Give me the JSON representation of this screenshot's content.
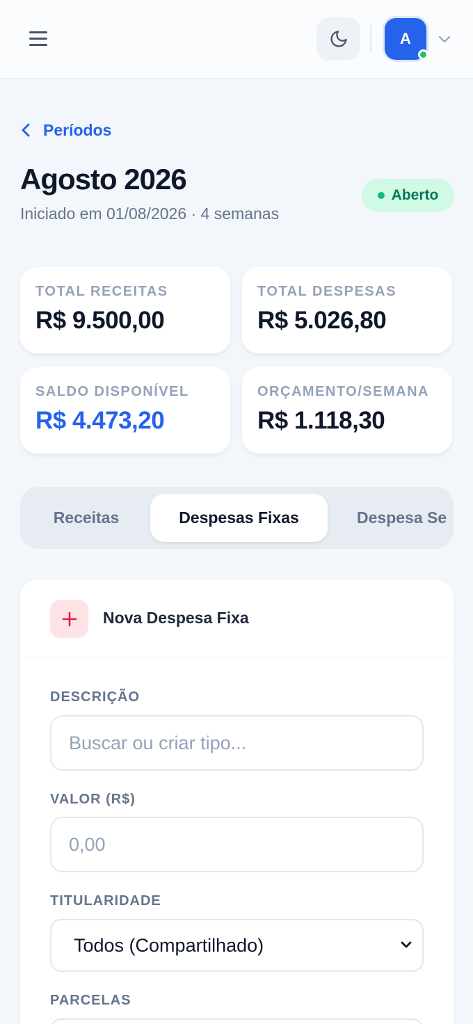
{
  "header": {
    "menu_icon": "hamburger-menu-icon",
    "theme_icon": "moon-icon",
    "avatar_initial": "A",
    "avatar_status": "online",
    "chevron_icon": "chevron-down-icon"
  },
  "nav": {
    "back_label": "Períodos"
  },
  "period": {
    "title": "Agosto 2026",
    "subtitle": "Iniciado em 01/08/2026 · 4 semanas",
    "status": "Aberto"
  },
  "stats": [
    {
      "label": "TOTAL RECEITAS",
      "value": "R$ 9.500,00"
    },
    {
      "label": "TOTAL DESPESAS",
      "value": "R$ 5.026,80"
    },
    {
      "label": "SALDO DISPONÍVEL",
      "value": "R$ 4.473,20"
    },
    {
      "label": "ORÇAMENTO/SEMANA",
      "value": "R$ 1.118,30"
    }
  ],
  "tabs": [
    {
      "label": "Receitas",
      "active": false
    },
    {
      "label": "Despesas Fixas",
      "active": true
    },
    {
      "label": "Despesa Se",
      "active": false
    }
  ],
  "form": {
    "title": "Nova Despesa Fixa",
    "description": {
      "label": "DESCRIÇÃO",
      "value": "",
      "placeholder": "Buscar ou criar tipo..."
    },
    "amount": {
      "label": "VALOR (R$)",
      "value": "",
      "placeholder": "0,00"
    },
    "ownership": {
      "label": "TITULARIDADE",
      "selected": "Todos (Compartilhado)"
    },
    "installments": {
      "label": "PARCELAS"
    }
  },
  "colors": {
    "accent": "#2563eb",
    "status_green": "#047857",
    "add_icon": "#e11d48",
    "background": "#f3f6fa"
  }
}
